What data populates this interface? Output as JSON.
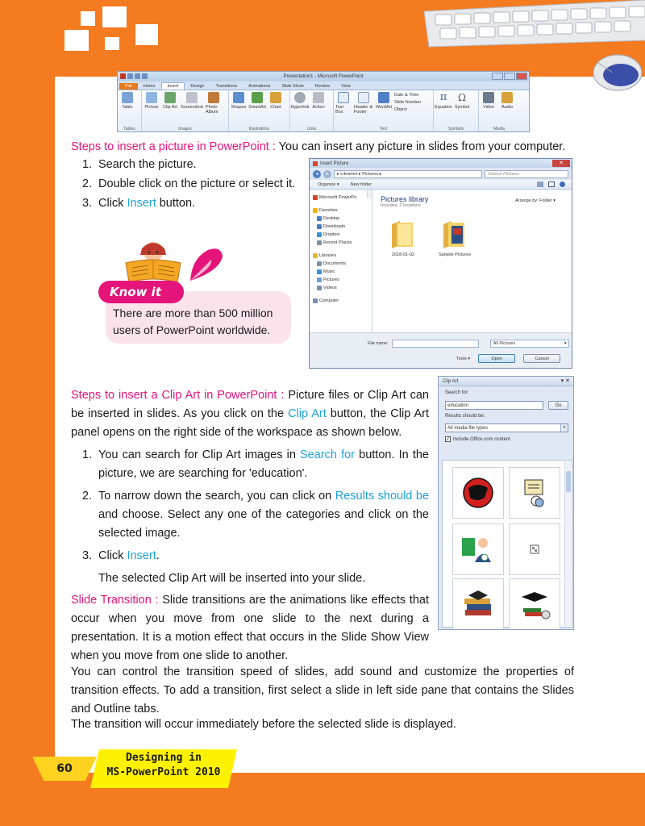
{
  "ribbon": {
    "window_title": "Presentation1 - Microsoft PowerPoint",
    "tabs": [
      "File",
      "Home",
      "Insert",
      "Design",
      "Transitions",
      "Animations",
      "Slide Show",
      "Review",
      "View"
    ],
    "groups": [
      {
        "label": "Tables",
        "items": [
          "Table"
        ]
      },
      {
        "label": "Images",
        "items": [
          "Picture",
          "Clip Art",
          "Screenshot",
          "Photo Album"
        ]
      },
      {
        "label": "Illustrations",
        "items": [
          "Shapes",
          "SmartArt",
          "Chart"
        ]
      },
      {
        "label": "Links",
        "items": [
          "Hyperlink",
          "Action"
        ]
      },
      {
        "label": "Text",
        "items": [
          "Text Box",
          "Header & Footer",
          "WordArt"
        ],
        "side_items": [
          "Date & Time",
          "Slide Number",
          "Object"
        ]
      },
      {
        "label": "Symbols",
        "items": [
          "Equation",
          "Symbol"
        ]
      },
      {
        "label": "Media",
        "items": [
          "Video",
          "Audio"
        ]
      }
    ]
  },
  "section1": {
    "heading": "Steps to insert a picture in PowerPoint :",
    "intro": " You can insert any picture in slides from your computer.",
    "steps": [
      {
        "num": "1.",
        "pre": "Search the picture.",
        "link": "",
        "post": ""
      },
      {
        "num": "2.",
        "pre": "Double click on the picture or select it.",
        "link": "",
        "post": ""
      },
      {
        "num": "3.",
        "pre": "Click ",
        "link": "Insert",
        "post": " button."
      }
    ]
  },
  "insert_dialog": {
    "title": "Insert Picture",
    "path": "▸ Libraries ▸ Pictures ▸",
    "search_placeholder": "Search Pictures",
    "organize": "Organize ▾",
    "new_folder": "New folder",
    "nav": [
      {
        "label": "Microsoft PowerPo",
        "indent": false,
        "color": "#d24726"
      },
      {
        "label": "Favorites",
        "indent": false,
        "color": "#f2b200"
      },
      {
        "label": "Desktop",
        "indent": true,
        "color": "#4a7fc0"
      },
      {
        "label": "Downloads",
        "indent": true,
        "color": "#4a7fc0"
      },
      {
        "label": "Dropbox",
        "indent": true,
        "color": "#3d8fd8"
      },
      {
        "label": "Recent Places",
        "indent": true,
        "color": "#7d8fa8"
      },
      {
        "label": "Libraries",
        "indent": false,
        "color": "#e4b73c"
      },
      {
        "label": "Documents",
        "indent": true,
        "color": "#7d8fa8"
      },
      {
        "label": "Music",
        "indent": true,
        "color": "#3d8fd8"
      },
      {
        "label": "Pictures",
        "indent": true,
        "color": "#6aa0d8"
      },
      {
        "label": "Videos",
        "indent": true,
        "color": "#7d8fa8"
      },
      {
        "label": "Computer",
        "indent": false,
        "color": "#7d8fa8"
      }
    ],
    "library_title": "Pictures library",
    "library_sub": "Includes: 2 locations",
    "arrange": "Arrange by:  Folder ▾",
    "folders": [
      "2018-01-02",
      "Sample Pictures"
    ],
    "file_name_label": "File name:",
    "file_type": "All Pictures",
    "tools": "Tools ▾",
    "open": "Open",
    "cancel": "Cancel"
  },
  "know_it": {
    "tag": "Know it",
    "text": "There are more than 500 million users of PowerPoint worldwide."
  },
  "section2": {
    "heading": "Steps to insert a Clip Art in PowerPoint :",
    "p1": " Picture files or Clip Art can be inserted in slides. As you click on the ",
    "link_clipart": "Clip Art",
    "p2": " button, the Clip Art panel opens on the right side of the workspace as shown below.",
    "step1_num": "1.",
    "step1_pre": "You can search for Clip Art images in ",
    "step1_link": "Search for",
    "step1_post": " button. In the picture, we are searching for 'education'.",
    "step2_num": "2.",
    "step2_pre": "To narrow down the search, you can click on ",
    "step2_link": "Results should be",
    "step2_post": " and choose. Select any one of the categories and click on the selected image.",
    "step3_num": "3.",
    "step3_pre": "Click ",
    "step3_link": "Insert",
    "step3_post": ".",
    "note": "The selected Clip Art will be inserted into your slide."
  },
  "clip_panel": {
    "title": "Clip Art",
    "search_label": "Search for:",
    "search_value": "education",
    "go": "Go",
    "results_label": "Results should be:",
    "results_value": "All media file types",
    "include_label": "Include Office.com content",
    "include_checked": "✓"
  },
  "section3": {
    "heading": "Slide Transition :",
    "p1": " Slide transitions are the animations like effects that occur when you move from one slide to the next during a presentation. It is a motion effect that occurs in the Slide Show View when you move from one slide to another.",
    "p2": "You can control the transition speed of slides, add sound and customize the properties of transition effects. To add a transition, first select a slide in left side pane that contains the Slides and Outline tabs.",
    "p3": "The transition will occur immediately before the selected slide is displayed."
  },
  "footer": {
    "page_number": "60",
    "title_line1": "Designing in",
    "title_line2": "MS-PowerPoint 2010"
  }
}
